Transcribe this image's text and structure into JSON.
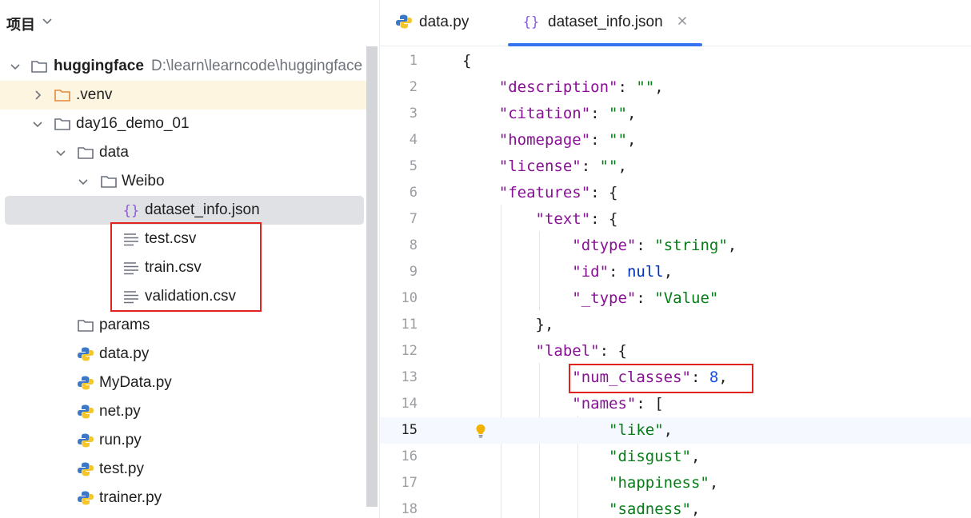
{
  "project": {
    "title": "项目",
    "tree": [
      {
        "label": "huggingface",
        "path": "D:\\learn\\learncode\\huggingface",
        "icon": "folder-icon",
        "expanded": true
      },
      {
        "label": ".venv",
        "icon": "folder-excluded-icon",
        "expanded": false
      },
      {
        "label": "day16_demo_01",
        "icon": "folder-icon",
        "expanded": true
      },
      {
        "label": "data",
        "icon": "folder-icon",
        "expanded": true
      },
      {
        "label": "Weibo",
        "icon": "folder-icon",
        "expanded": true
      },
      {
        "label": "dataset_info.json",
        "icon": "json-file-icon",
        "selected": true
      },
      {
        "label": "test.csv",
        "icon": "text-file-icon"
      },
      {
        "label": "train.csv",
        "icon": "text-file-icon"
      },
      {
        "label": "validation.csv",
        "icon": "text-file-icon"
      },
      {
        "label": "params",
        "icon": "folder-icon"
      },
      {
        "label": "data.py",
        "icon": "python-file-icon"
      },
      {
        "label": "MyData.py",
        "icon": "python-file-icon"
      },
      {
        "label": "net.py",
        "icon": "python-file-icon"
      },
      {
        "label": "run.py",
        "icon": "python-file-icon"
      },
      {
        "label": "test.py",
        "icon": "python-file-icon"
      },
      {
        "label": "trainer.py",
        "icon": "python-file-icon"
      }
    ]
  },
  "tabs": [
    {
      "label": "data.py",
      "icon": "python-file-icon",
      "active": false
    },
    {
      "label": "dataset_info.json",
      "icon": "json-file-icon",
      "active": true
    }
  ],
  "editor": {
    "current_line": 15,
    "lines": [
      {
        "n": "1",
        "t": "{"
      },
      {
        "n": "2",
        "t": "    \"description\": \"\","
      },
      {
        "n": "3",
        "t": "    \"citation\": \"\","
      },
      {
        "n": "4",
        "t": "    \"homepage\": \"\","
      },
      {
        "n": "5",
        "t": "    \"license\": \"\","
      },
      {
        "n": "6",
        "t": "    \"features\": {"
      },
      {
        "n": "7",
        "t": "        \"text\": {"
      },
      {
        "n": "8",
        "t": "            \"dtype\": \"string\","
      },
      {
        "n": "9",
        "t": "            \"id\": null,"
      },
      {
        "n": "10",
        "t": "            \"_type\": \"Value\""
      },
      {
        "n": "11",
        "t": "        },"
      },
      {
        "n": "12",
        "t": "        \"label\": {"
      },
      {
        "n": "13",
        "t": "            \"num_classes\": 8,"
      },
      {
        "n": "14",
        "t": "            \"names\": ["
      },
      {
        "n": "15",
        "t": "                \"like\","
      },
      {
        "n": "16",
        "t": "                \"disgust\","
      },
      {
        "n": "17",
        "t": "                \"happiness\","
      },
      {
        "n": "18",
        "t": "                \"sadness\","
      }
    ]
  },
  "colors": {
    "accent": "#3574f0",
    "highlight_box": "#e0231f",
    "json_key": "#871094",
    "json_string": "#067d17",
    "json_number": "#1750eb",
    "json_keyword": "#0033b3"
  }
}
